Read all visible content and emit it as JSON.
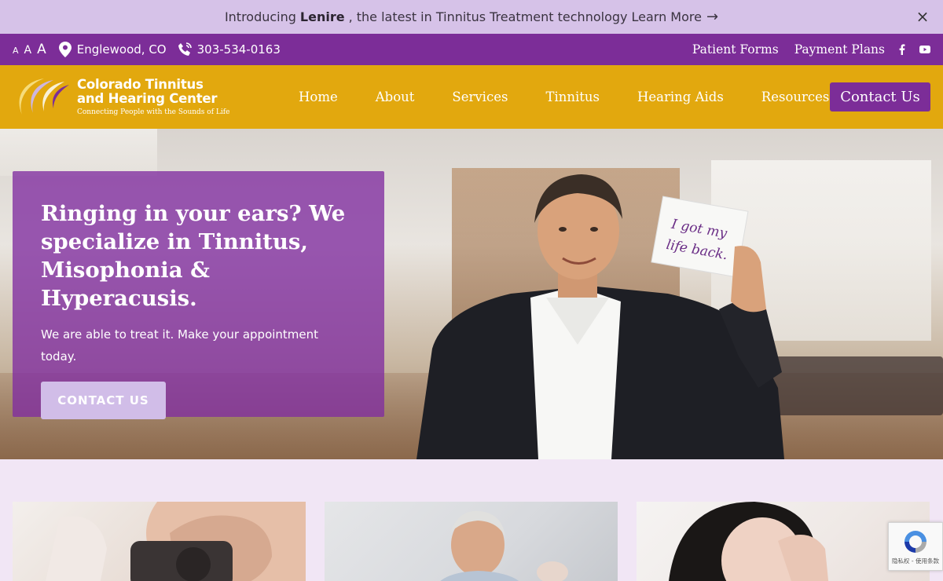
{
  "announcement": {
    "prefix": "Introducing",
    "brand": "Lenire",
    "suffix": ", the latest in Tinnitus Treatment technology",
    "link": "Learn More",
    "arrow": "→",
    "close": "×"
  },
  "utility": {
    "font_sizes": [
      "A",
      "A",
      "A"
    ],
    "location": "Englewood, CO",
    "phone": "303-534-0163",
    "links": [
      "Patient Forms",
      "Payment Plans"
    ],
    "social": [
      "facebook-icon",
      "youtube-icon"
    ]
  },
  "header": {
    "logo_line1": "Colorado Tinnitus",
    "logo_line2": "and Hearing Center",
    "logo_tagline": "Connecting People with the Sounds of Life",
    "nav": [
      "Home",
      "About",
      "Services",
      "Tinnitus",
      "Hearing Aids",
      "Resources"
    ],
    "cta": "Contact Us"
  },
  "hero": {
    "title": "Ringing in your ears? We specialize in Tinnitus, Misophonia & Hyperacusis.",
    "subtitle": "We are able to treat it. Make your appointment today.",
    "button": "CONTACT US",
    "sign_line1": "I got my",
    "sign_line2": "life back."
  },
  "recaptcha": {
    "text": "隐私权 - 使用条款"
  },
  "colors": {
    "purple": "#7c2d98",
    "gold": "#e2a80e",
    "lavender": "#d6c2e8"
  }
}
